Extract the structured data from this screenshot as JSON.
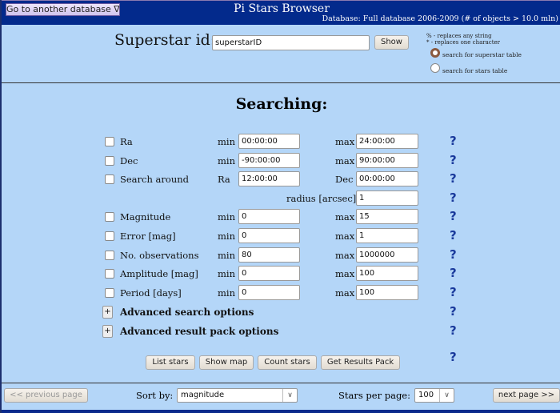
{
  "header": {
    "db_button": "Go to another database ∇",
    "title": "Pi Stars Browser",
    "db_info": "Database: Full database 2006-2009 (# of objects > 10.0 mln)"
  },
  "superstar": {
    "label": "Superstar id:",
    "value": "superstarID",
    "show": "Show",
    "hint1": "% - replaces any string",
    "hint2": "* - replaces one character",
    "radio1": "search for superstar table",
    "radio2": "search for stars table",
    "radio_selected": "superstar"
  },
  "search": {
    "title": "Searching:",
    "help": "?",
    "rows": [
      {
        "label": "Ra",
        "l1": "min",
        "v1": "00:00:00",
        "l2": "max",
        "v2": "24:00:00"
      },
      {
        "label": "Dec",
        "l1": "min",
        "v1": "-90:00:00",
        "l2": "max",
        "v2": "90:00:00"
      },
      {
        "label": "Search around",
        "l1": "Ra",
        "v1": "12:00:00",
        "l2": "Dec",
        "v2": "00:00:00"
      },
      {
        "label": "",
        "l1": "",
        "v1": "",
        "l2": "radius [arcsec]",
        "v2": "1"
      },
      {
        "label": "Magnitude",
        "l1": "min",
        "v1": "0",
        "l2": "max",
        "v2": "15"
      },
      {
        "label": "Error [mag]",
        "l1": "min",
        "v1": "0",
        "l2": "max",
        "v2": "1"
      },
      {
        "label": "No. observations",
        "l1": "min",
        "v1": "80",
        "l2": "max",
        "v2": "1000000"
      },
      {
        "label": "Amplitude [mag]",
        "l1": "min",
        "v1": "0",
        "l2": "max",
        "v2": "100"
      },
      {
        "label": "Period [days]",
        "l1": "min",
        "v1": "0",
        "l2": "max",
        "v2": "100"
      }
    ],
    "advanced_search": "Advanced search options",
    "advanced_result": "Advanced result pack options",
    "plus": "+"
  },
  "actions": {
    "list": "List stars",
    "map": "Show map",
    "count": "Count stars",
    "pack": "Get Results Pack"
  },
  "footer": {
    "prev": "<< previous page",
    "sort_label": "Sort by:",
    "sort_value": "magnitude",
    "per_page_label": "Stars per page:",
    "per_page_value": "100",
    "next": "next page >>"
  }
}
